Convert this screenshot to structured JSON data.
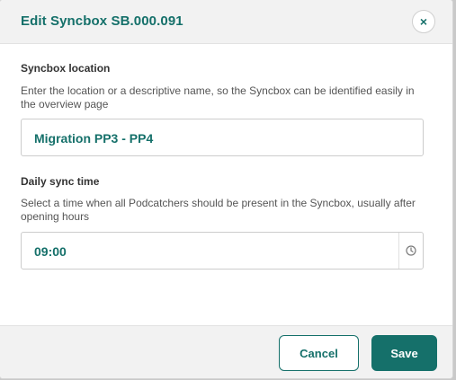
{
  "dialog": {
    "title": "Edit Syncbox SB.000.091",
    "close_icon": "close-icon",
    "close_glyph": "×"
  },
  "location": {
    "label": "Syncbox location",
    "help": "Enter the location or a descriptive name, so the Syncbox can be identified easily in the overview page",
    "value": "Migration PP3 - PP4"
  },
  "sync_time": {
    "label": "Daily sync time",
    "help": "Select a time when all Podcatchers should be present in the Syncbox, usually after opening hours",
    "value": "09:00",
    "icon": "clock-icon"
  },
  "footer": {
    "cancel_label": "Cancel",
    "save_label": "Save"
  },
  "colors": {
    "accent": "#15706a",
    "header_bg": "#f2f2f2"
  }
}
